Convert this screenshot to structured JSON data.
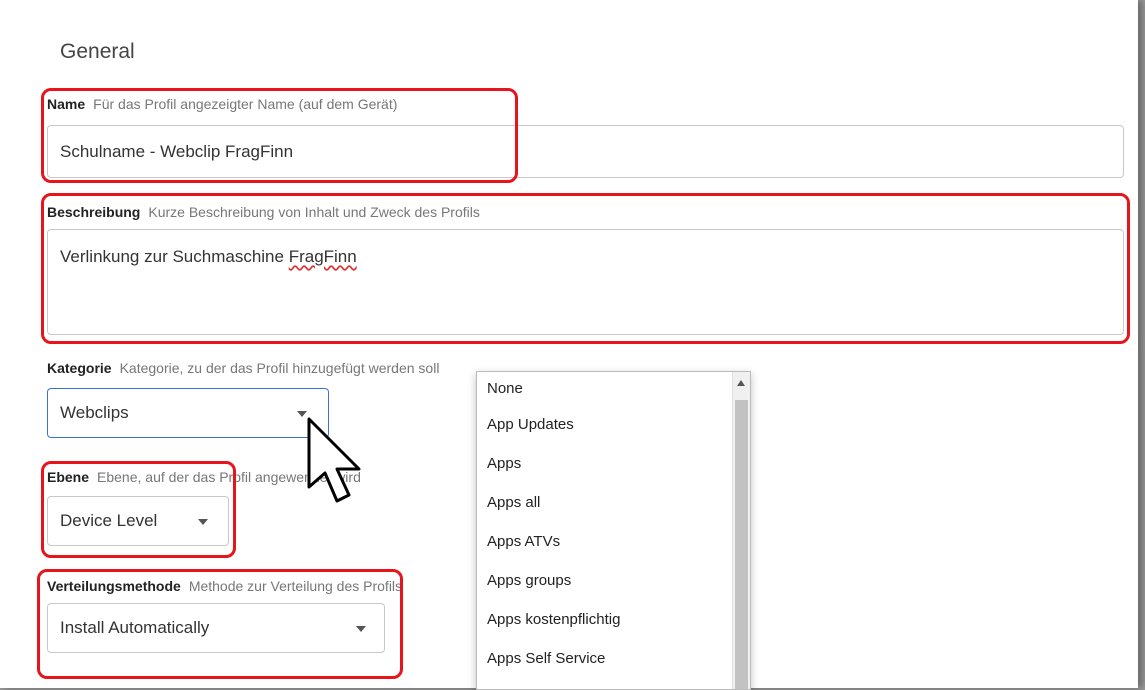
{
  "section": {
    "title": "General"
  },
  "name": {
    "label": "Name",
    "hint": "Für das Profil angezeigter Name (auf dem Gerät)",
    "value": "Schulname - Webclip FragFinn"
  },
  "beschreibung": {
    "label": "Beschreibung",
    "hint": "Kurze Beschreibung von Inhalt und Zweck des Profils",
    "value_prefix": "Verlinkung zur Suchmaschine ",
    "value_misspelled": "FragFinn"
  },
  "kategorie": {
    "label": "Kategorie",
    "hint": "Kategorie, zu der das Profil hinzugefügt werden soll",
    "selected": "Webclips"
  },
  "ebene": {
    "label": "Ebene",
    "hint": "Ebene, auf der das Profil angewendet wird",
    "selected": "Device Level"
  },
  "verteilungsmethode": {
    "label": "Verteilungsmethode",
    "hint": "Methode zur Verteilung des Profils",
    "selected": "Install Automatically"
  },
  "dropdown": {
    "options": [
      "None",
      "App Updates",
      "Apps",
      "Apps all",
      "Apps ATVs",
      "Apps groups",
      "Apps kostenpflichtig",
      "Apps Self Service"
    ]
  },
  "colors": {
    "highlight": "#e8141c",
    "focus_border": "#3b73d4"
  }
}
